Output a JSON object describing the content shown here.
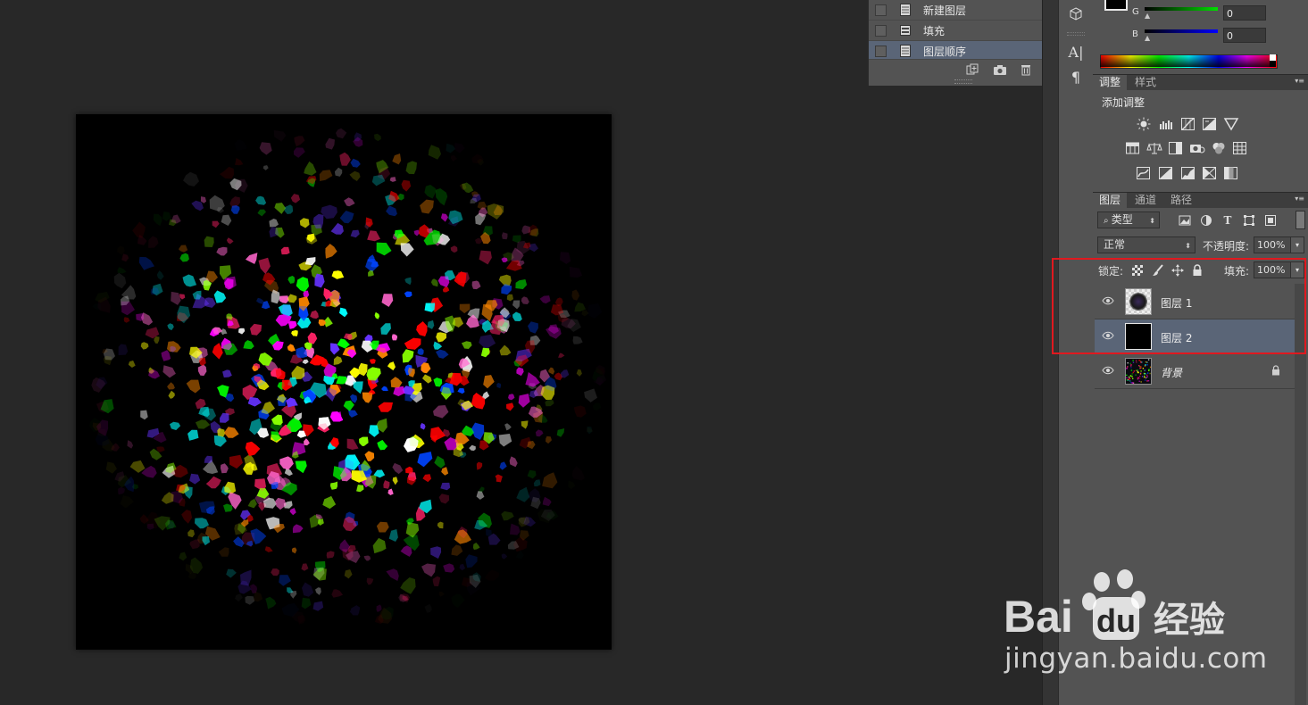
{
  "history": {
    "items": [
      {
        "label": "新建图层",
        "icon": "history-state-icon",
        "selected": false
      },
      {
        "label": "填充",
        "icon": "history-fill-state-icon",
        "selected": false
      },
      {
        "label": "图层顺序",
        "icon": "history-state-icon",
        "selected": true
      }
    ]
  },
  "color": {
    "g_label": "G",
    "b_label": "B",
    "g_value": "0",
    "b_value": "0",
    "g_color": "#00c000",
    "b_color": "#0000ff"
  },
  "adjustments": {
    "tabs": [
      "调整",
      "样式"
    ],
    "title": "添加调整"
  },
  "layers": {
    "tabs": [
      "图层",
      "通道",
      "路径"
    ],
    "filter_kind": "类型",
    "blend_mode": "正常",
    "opacity_label": "不透明度:",
    "opacity_value": "100%",
    "lock_label": "锁定:",
    "fill_label": "填充:",
    "fill_value": "100%",
    "rows": [
      {
        "name": "图层 1",
        "selected": false,
        "locked": false
      },
      {
        "name": "图层 2",
        "selected": true,
        "locked": false
      },
      {
        "name": "背景",
        "selected": false,
        "locked": true
      }
    ]
  },
  "watermark": {
    "brand": "Bai",
    "brand_du": "du",
    "brand_cn": "经验",
    "url": "jingyan.baidu.com"
  },
  "theme": {
    "highlight_color": "#e0191f",
    "selection_color": "#5a6577"
  }
}
